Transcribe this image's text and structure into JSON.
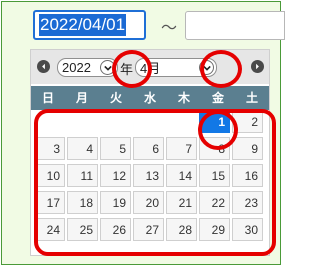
{
  "date_from": {
    "value": "2022/04/01"
  },
  "range_separator": "～",
  "date_to": {
    "value": ""
  },
  "calendar": {
    "year_select": {
      "value": "2022"
    },
    "year_suffix": "年",
    "month_select": {
      "value": "4月"
    },
    "weekdays": [
      "日",
      "月",
      "火",
      "水",
      "木",
      "金",
      "土"
    ],
    "weeks": [
      [
        "",
        "",
        "",
        "",
        "",
        "1",
        "2"
      ],
      [
        "3",
        "4",
        "5",
        "6",
        "7",
        "8",
        "9"
      ],
      [
        "10",
        "11",
        "12",
        "13",
        "14",
        "15",
        "16"
      ],
      [
        "17",
        "18",
        "19",
        "20",
        "21",
        "22",
        "23"
      ],
      [
        "24",
        "25",
        "26",
        "27",
        "28",
        "29",
        "30"
      ]
    ],
    "selected_day": "1"
  },
  "colors": {
    "accent": "#1278e6",
    "header_band": "#5b7f90",
    "highlight": "#e50000",
    "frame_bg": "#f1fbe4"
  },
  "icons": {
    "prev": "chevron-left-icon",
    "next": "chevron-right-icon",
    "dropdown": "chevron-down-icon"
  }
}
